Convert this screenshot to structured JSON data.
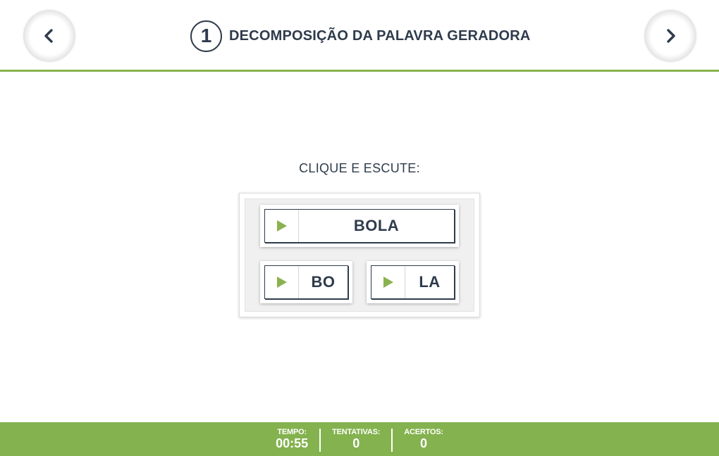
{
  "header": {
    "step_number": "1",
    "title": "DECOMPOSIÇÃO DA PALAVRA GERADORA",
    "prev_icon": "chevron-left-icon",
    "next_icon": "chevron-right-icon"
  },
  "main": {
    "instruction": "CLIQUE E ESCUTE:",
    "word_button": {
      "label": "BOLA",
      "icon": "play-icon"
    },
    "syllable_buttons": [
      {
        "label": "BO",
        "icon": "play-icon"
      },
      {
        "label": "LA",
        "icon": "play-icon"
      }
    ]
  },
  "footer": {
    "time_label": "TEMPO:",
    "time_value": "00:55",
    "attempts_label": "TENTATIVAS:",
    "attempts_value": "0",
    "hits_label": "ACERTOS:",
    "hits_value": "0"
  },
  "colors": {
    "accent_green": "#84b24e",
    "play_green": "#8ab24f",
    "text_dark": "#2f3b4c"
  }
}
